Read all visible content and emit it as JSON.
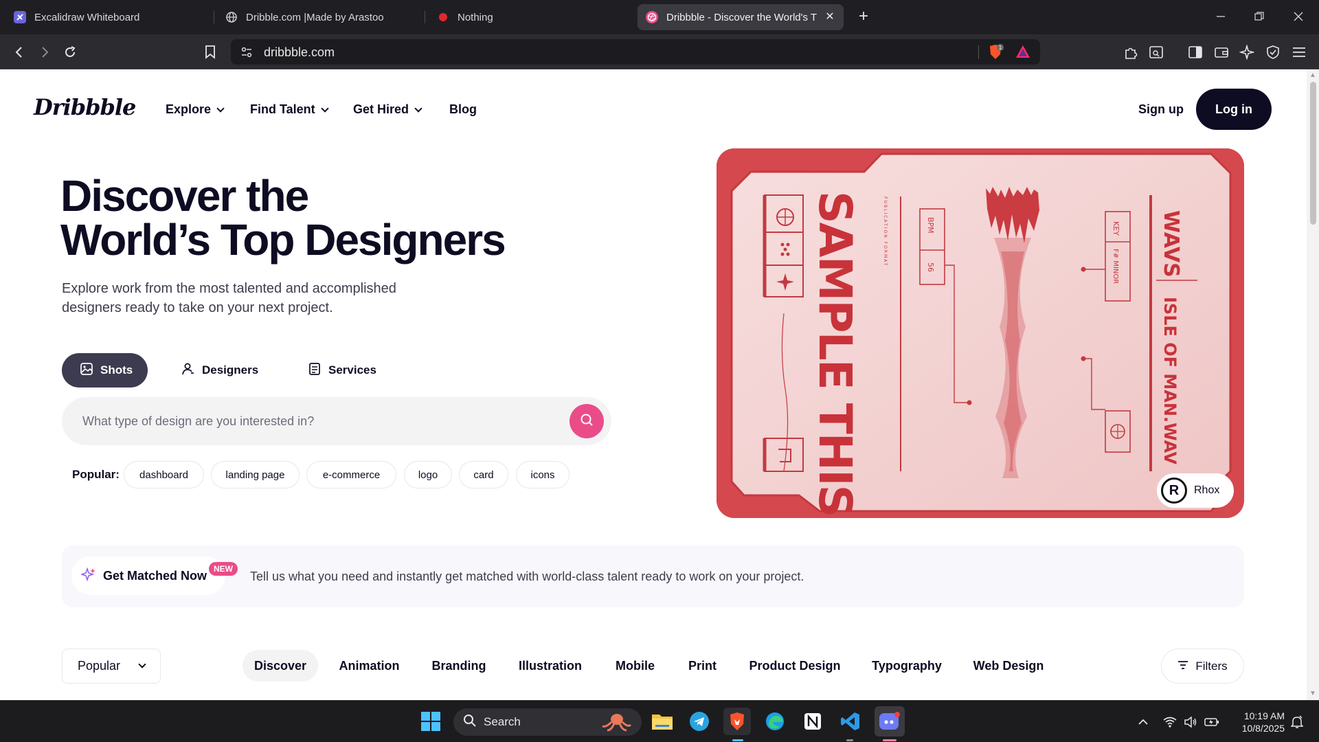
{
  "browser": {
    "tabs": [
      {
        "title": "Excalidraw Whiteboard",
        "icon": "excalidraw-icon"
      },
      {
        "title": "Dribble.com |Made by Arastoo",
        "icon": "globe-icon"
      },
      {
        "title": "Nothing",
        "icon": "red-dot-icon"
      },
      {
        "title": "Dribbble - Discover the World's T",
        "icon": "dribbble-icon",
        "active": true
      }
    ],
    "url": "dribbble.com",
    "shield_count": "1"
  },
  "nav": {
    "logo": "Dribbble",
    "items": [
      {
        "label": "Explore",
        "dropdown": true
      },
      {
        "label": "Find Talent",
        "dropdown": true
      },
      {
        "label": "Get Hired",
        "dropdown": true
      },
      {
        "label": "Blog",
        "dropdown": false
      }
    ],
    "signup": "Sign up",
    "login": "Log in"
  },
  "hero": {
    "title_line1": "Discover the",
    "title_line2": "World’s Top Designers",
    "subtitle_line1": "Explore work from the most talented and accomplished",
    "subtitle_line2": "designers ready to take on your next project.",
    "search_tabs": [
      {
        "label": "Shots",
        "icon": "image-icon",
        "active": true
      },
      {
        "label": "Designers",
        "icon": "user-icon",
        "active": false
      },
      {
        "label": "Services",
        "icon": "list-icon",
        "active": false
      }
    ],
    "search_placeholder": "What type of design are you interested in?",
    "popular_label": "Popular:",
    "popular_tags": [
      "dashboard",
      "landing page",
      "e-commerce",
      "logo",
      "card",
      "icons"
    ],
    "card": {
      "main_text": "SAMPLE THIS",
      "side_text_1": "WAVS",
      "side_text_2": "ISLE OF MAN.WAV",
      "bpm_label": "BPM",
      "bpm_value": "56",
      "key_label": "KEY",
      "key_value": "F# MINOR",
      "small_text": "PUBLICATION FORMAT",
      "author": "Rhox",
      "author_initial": "R"
    }
  },
  "match": {
    "button": "Get Matched Now",
    "badge": "NEW",
    "text": "Tell us what you need and instantly get matched with world-class talent ready to work on your project."
  },
  "feed": {
    "sort": "Popular",
    "categories": [
      "Discover",
      "Animation",
      "Branding",
      "Illustration",
      "Mobile",
      "Print",
      "Product Design",
      "Typography",
      "Web Design"
    ],
    "active_category": "Discover",
    "filters": "Filters"
  },
  "taskbar": {
    "search": "Search",
    "time": "10:19 AM",
    "date": "10/8/2025"
  },
  "colors": {
    "brand_pink": "#ea4c89",
    "ink": "#0d0c22",
    "card_red": "#d5484e",
    "card_paper": "#f3d2d2"
  }
}
